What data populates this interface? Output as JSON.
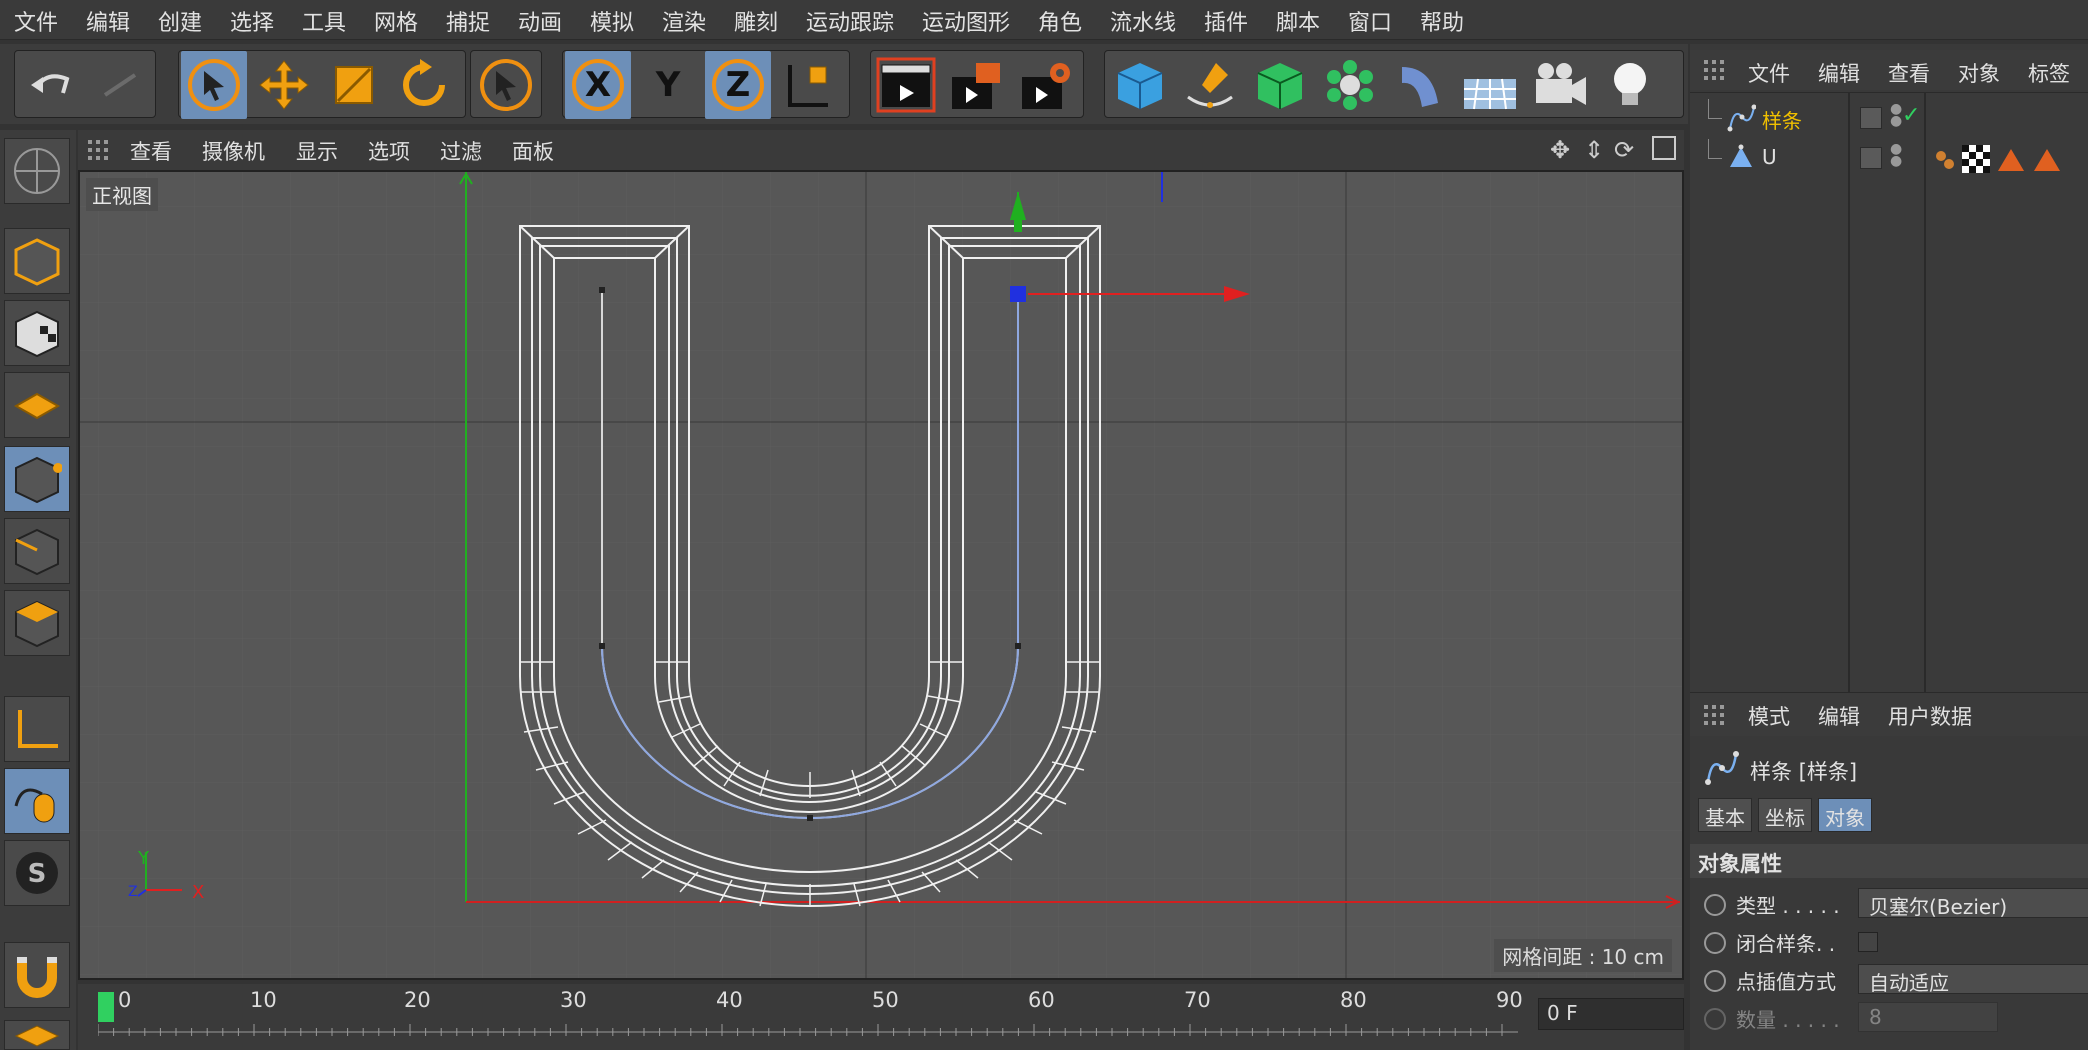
{
  "menubar": {
    "items": [
      "文件",
      "编辑",
      "创建",
      "选择",
      "工具",
      "网格",
      "捕捉",
      "动画",
      "模拟",
      "渲染",
      "雕刻",
      "运动跟踪",
      "运动图形",
      "角色",
      "流水线",
      "插件",
      "脚本",
      "窗口",
      "帮助"
    ]
  },
  "toolbar": {
    "axis_x": "X",
    "axis_y": "Y",
    "axis_z": "Z"
  },
  "viewport": {
    "menu": [
      "查看",
      "摄像机",
      "显示",
      "选项",
      "过滤",
      "面板"
    ],
    "label": "正视图",
    "grid_spacing": "网格间距 : 10 cm",
    "axis_y": "Y",
    "axis_x": "X",
    "axis_z": "Z"
  },
  "timeline": {
    "ticks": [
      "0",
      "10",
      "20",
      "30",
      "40",
      "50",
      "60",
      "70",
      "80",
      "90"
    ],
    "current_frame": "0 F"
  },
  "object_manager": {
    "menu": [
      "文件",
      "编辑",
      "查看",
      "对象",
      "标签"
    ],
    "objects": [
      {
        "name": "样条",
        "color": "#f0c000"
      },
      {
        "name": "U",
        "color": "#e0e0e0"
      }
    ]
  },
  "attributes": {
    "menu": [
      "模式",
      "编辑",
      "用户数据"
    ],
    "title": "样条 [样条]",
    "tabs": [
      "基本",
      "坐标",
      "对象"
    ],
    "section": "对象属性",
    "props": [
      {
        "label": "类型 . . . . .",
        "value": "贝塞尔(Bezier)"
      },
      {
        "label": "闭合样条. .",
        "value": ""
      },
      {
        "label": "点插值方式",
        "value": "自动适应"
      },
      {
        "label": "数量 . . . . .",
        "value": "8"
      }
    ]
  },
  "colors": {
    "accent_blue": "#6d8fb8",
    "spline_yellow": "#f0c000",
    "axis_red": "#e02020",
    "axis_green": "#20b020",
    "axis_blue": "#2030e0"
  }
}
